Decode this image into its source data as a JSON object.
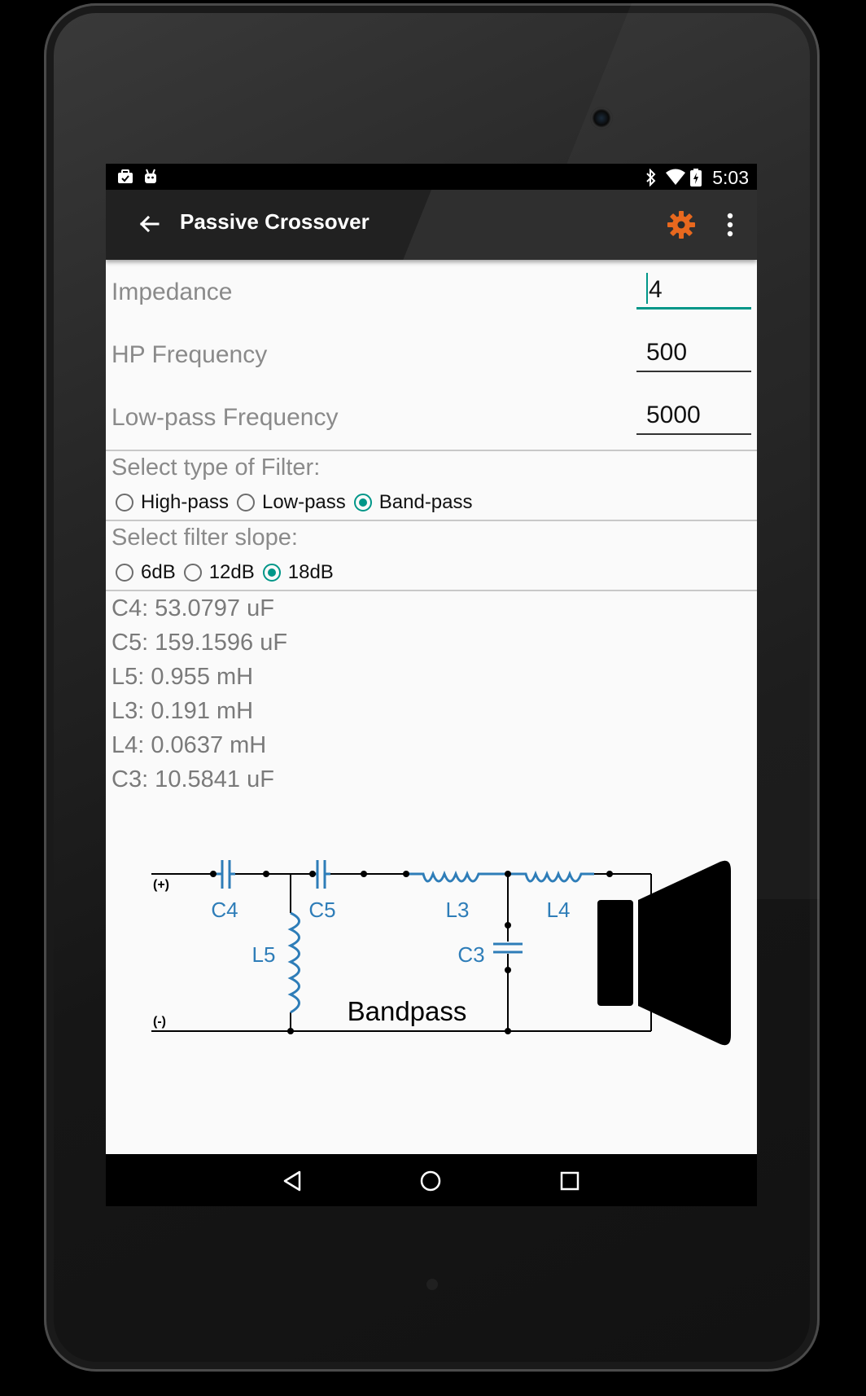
{
  "status_bar": {
    "time": "5:03",
    "left_icons": [
      "briefcase-icon",
      "android-icon"
    ],
    "right_icons": [
      "bluetooth-icon",
      "wifi-icon",
      "battery-icon"
    ]
  },
  "app_bar": {
    "title": "Passive Crossover",
    "back_icon": "arrow-back-icon",
    "settings_icon": "gear-icon",
    "overflow_icon": "more-vert-icon",
    "accent": "#e8681e"
  },
  "form": {
    "impedance": {
      "label": "Impedance",
      "value": "4"
    },
    "hp_frequency": {
      "label": "HP Frequency",
      "value": "500"
    },
    "lp_frequency": {
      "label": "Low-pass Frequency",
      "value": "5000"
    }
  },
  "filter_type": {
    "label": "Select type of Filter:",
    "options": [
      {
        "label": "High-pass",
        "selected": false
      },
      {
        "label": "Low-pass",
        "selected": false
      },
      {
        "label": "Band-pass",
        "selected": true
      }
    ]
  },
  "filter_slope": {
    "label": "Select filter slope:",
    "options": [
      {
        "label": "6dB",
        "selected": false
      },
      {
        "label": "12dB",
        "selected": false
      },
      {
        "label": "18dB",
        "selected": true
      }
    ]
  },
  "results": [
    "C4: 53.0797 uF",
    "C5: 159.1596 uF",
    "L5: 0.955 mH",
    "L3: 0.191 mH",
    "L4: 0.0637 mH",
    "C3: 10.5841 uF"
  ],
  "schematic": {
    "title": "Bandpass",
    "plus_label": "(+)",
    "minus_label": "(-)",
    "component_labels": {
      "c4": "C4",
      "c5": "C5",
      "l5": "L5",
      "l3": "L3",
      "l4": "L4",
      "c3": "C3"
    },
    "component_color": "#2e7db8"
  },
  "nav_bar": {
    "back_icon": "nav-back-icon",
    "home_icon": "nav-home-icon",
    "recents_icon": "nav-recents-icon"
  },
  "accent_color": "#009688"
}
